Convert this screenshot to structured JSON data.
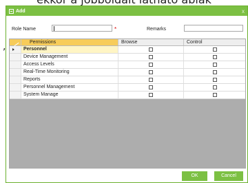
{
  "background": {
    "caption": "ekkor a jobboldalt látható ablak",
    "comma": ","
  },
  "dialog": {
    "title": "Add",
    "close_glyph": "x",
    "accent_color": "#7cc043"
  },
  "form": {
    "role_name_label": "Role Name",
    "role_name_value": "",
    "required_mark": "*",
    "remarks_label": "Remarks",
    "remarks_value": ""
  },
  "grid": {
    "columns": [
      "Permissions",
      "Browse",
      "Control"
    ],
    "selected_row": 0,
    "rows": [
      {
        "name": "Personnel",
        "browse": false,
        "control": false
      },
      {
        "name": "Device Management",
        "browse": false,
        "control": false
      },
      {
        "name": "Access Levels",
        "browse": false,
        "control": false
      },
      {
        "name": "Real-Time Monitoring",
        "browse": false,
        "control": false
      },
      {
        "name": "Reports",
        "browse": false,
        "control": false
      },
      {
        "name": "Personnel Management",
        "browse": false,
        "control": false
      },
      {
        "name": "System Manage",
        "browse": false,
        "control": false
      }
    ]
  },
  "buttons": {
    "ok": "OK",
    "cancel": "Cancel"
  }
}
